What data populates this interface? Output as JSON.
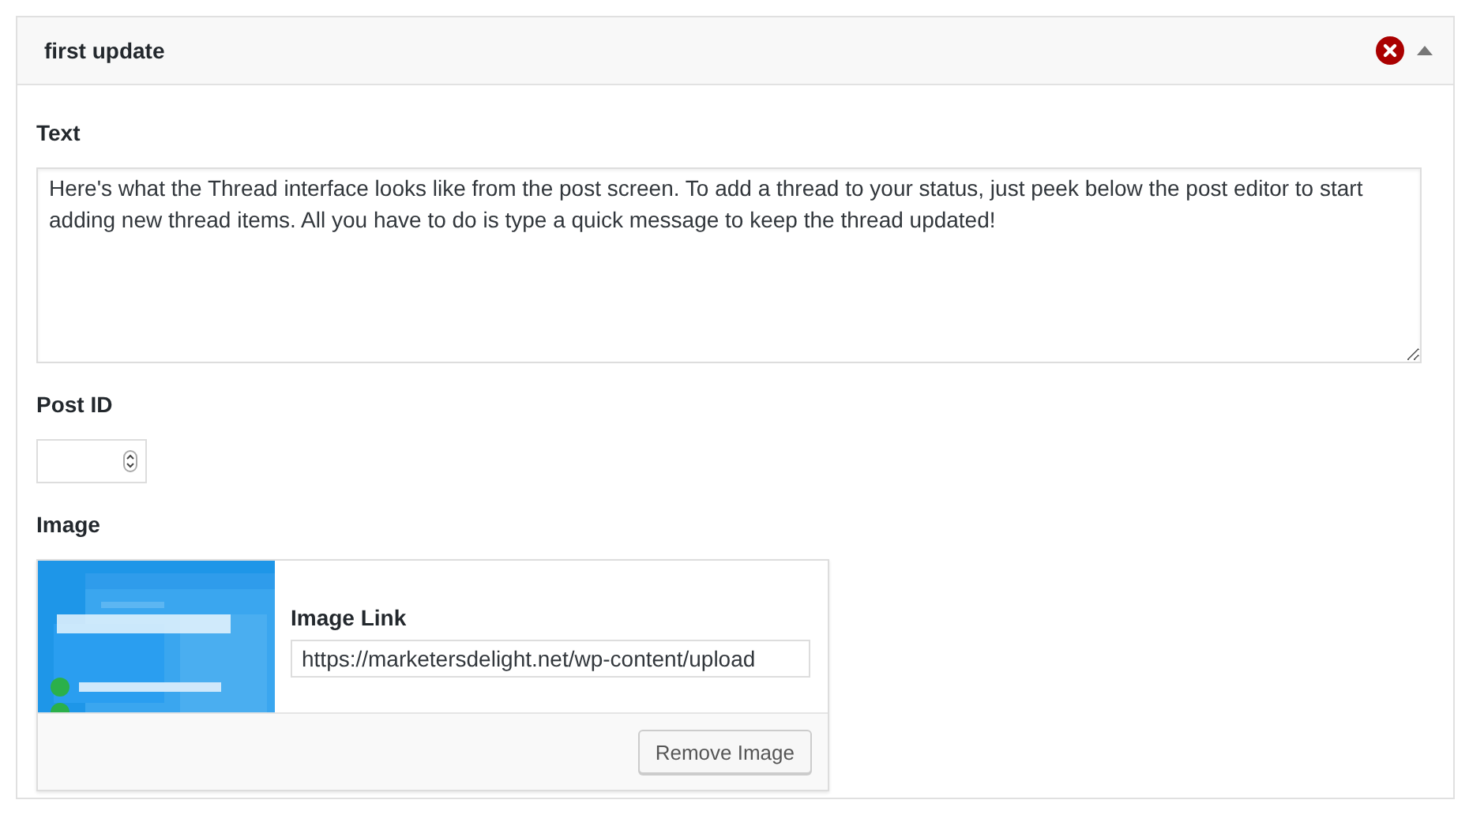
{
  "panel": {
    "title": "first update",
    "expanded": true
  },
  "text_field": {
    "label": "Text",
    "value": "Here's what the Thread interface looks like from the post screen. To add a thread to your status, just peek below the post editor to start adding new thread items. All you have to do is type a quick message to keep the thread updated!"
  },
  "post_id": {
    "label": "Post ID"
  },
  "image": {
    "label": "Image",
    "link_label": "Image Link",
    "link_value": "https://marketersdelight.net/wp-content/upload",
    "remove_button": "Remove Image"
  }
}
